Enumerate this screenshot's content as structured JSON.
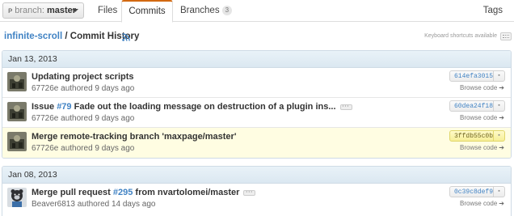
{
  "topbar": {
    "branch_prefix": "branch:",
    "branch_name": "master",
    "tabs": {
      "files": "Files",
      "commits": "Commits",
      "branches": "Branches",
      "branches_count": "3",
      "tags": "Tags"
    }
  },
  "header": {
    "repo": "infinite-scroll",
    "separator": " / ",
    "title": "Commit History",
    "keyboard_hint": "Keyboard shortcuts available"
  },
  "groups": [
    {
      "date": "Jan 13, 2013",
      "commits": [
        {
          "message": "Updating project scripts",
          "author_line": "67726e authored 9 days ago",
          "sha": "614efa3015",
          "browse": "Browse code",
          "highlighted": false
        },
        {
          "message_prefix": "Issue ",
          "message_ref": "#79",
          "message_suffix": " Fade out the loading message on destruction of a plugin ins...",
          "author_line": "67726e authored 9 days ago",
          "sha": "60dea24f18",
          "browse": "Browse code",
          "highlighted": false
        },
        {
          "message": "Merge remote-tracking branch 'maxpage/master'",
          "author_line": "67726e authored 9 days ago",
          "sha": "3ffdb55c0b",
          "browse": "Browse code",
          "highlighted": true
        }
      ]
    },
    {
      "date": "Jan 08, 2013",
      "commits": [
        {
          "message_prefix": "Merge pull request ",
          "message_ref": "#295",
          "message_suffix": " from nvartolomei/master",
          "author_line": "Beaver6813 authored 14 days ago",
          "sha": "0c39c8def9",
          "browse": "Browse code",
          "highlighted": false
        }
      ]
    }
  ],
  "colors": {
    "link": "#4183c4",
    "active_tab_accent": "#d26911",
    "group_header_bg": "#e3eef5",
    "highlight_bg": "#fffde2"
  },
  "icons": {
    "branch": "branch-icon",
    "rss": "rss-icon",
    "keyboard": "keyboard-icon",
    "clipboard": "clipboard-icon",
    "browse": "arrow-right-icon"
  }
}
